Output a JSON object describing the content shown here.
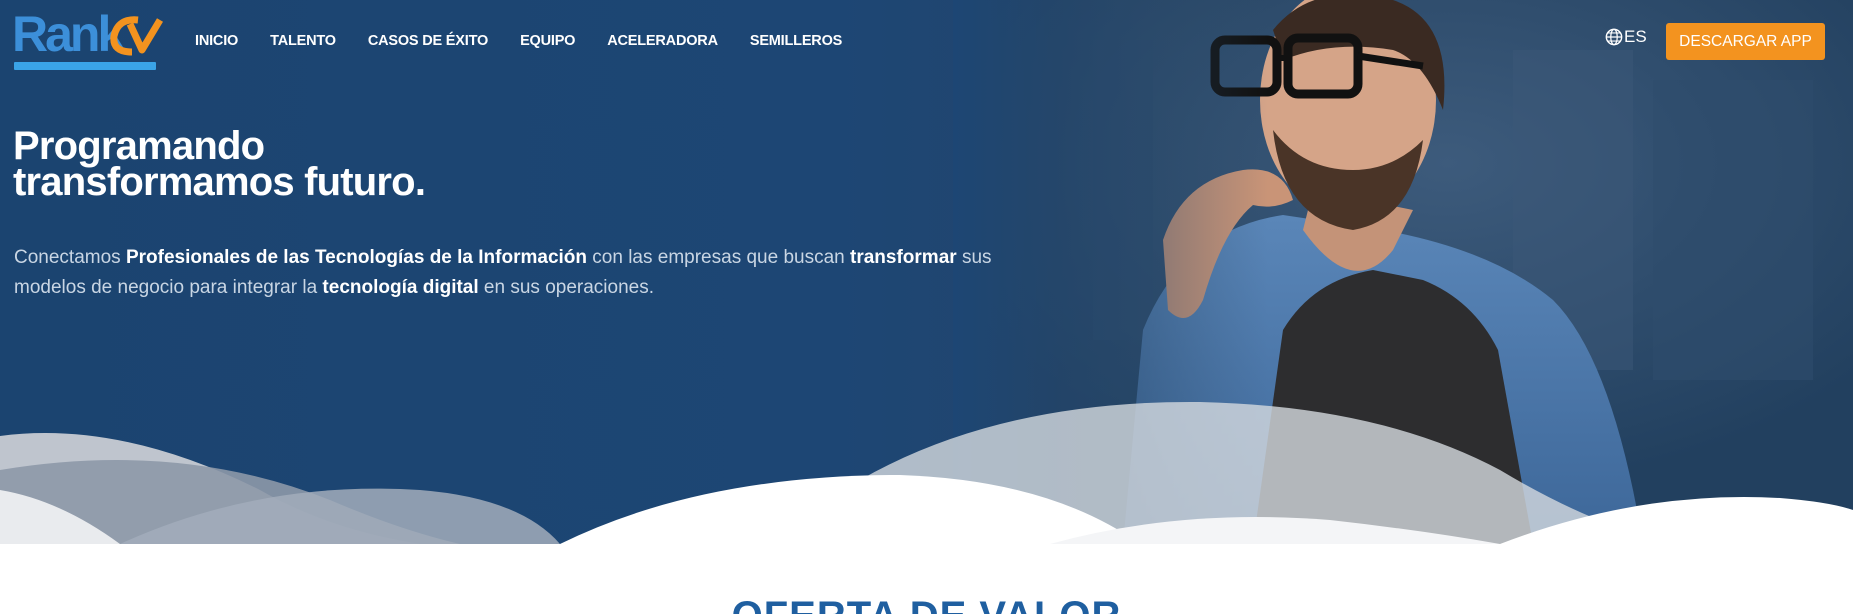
{
  "brand": {
    "logo_text": "Rank",
    "logo_mark": "CV",
    "colors": {
      "logo_blue": "#3c8fd9",
      "logo_orange": "#f3931f"
    }
  },
  "nav": {
    "items": [
      {
        "label": "INICIO"
      },
      {
        "label": "TALENTO"
      },
      {
        "label": "CASOS DE ÉXITO"
      },
      {
        "label": "EQUIPO"
      },
      {
        "label": "ACELERADORA"
      },
      {
        "label": "SEMILLEROS"
      }
    ],
    "language": {
      "icon": "globe-icon",
      "label": "ES"
    },
    "cta_label": "DESCARGAR APP"
  },
  "hero": {
    "headline_line1": "Programando",
    "headline_line2": "transformamos futuro.",
    "lead": {
      "p1": "Conectamos ",
      "b1": "Profesionales de las Tecnologías de la Información",
      "p2": " con las empresas que buscan ",
      "b2": "transformar",
      "p3": " sus modelos de negocio para integrar la ",
      "b3": "tecnología digital",
      "p4": " en sus operaciones."
    }
  },
  "section": {
    "title": "OFERTA DE VALOR"
  },
  "colors": {
    "hero_bg": "#1d4674",
    "cta_bg": "#f3931f",
    "section_title": "#1f5fa0"
  }
}
